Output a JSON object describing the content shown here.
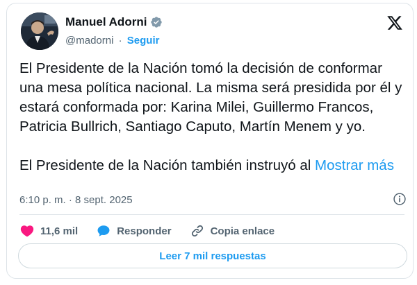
{
  "user": {
    "name": "Manuel Adorni",
    "handle": "@madorni",
    "separator": "·",
    "follow_label": "Seguir"
  },
  "tweet": {
    "paragraph1": "El Presidente de la Nación tomó la decisión de conformar una mesa política nacional. La misma será presidida por él y estará conformada por: Karina Milei, Guillermo Francos, Patricia Bullrich, Santiago Caputo, Martín Menem y yo.",
    "paragraph2": "El Presidente de la Nación también instruyó al ",
    "show_more": "Mostrar más",
    "timestamp": "6:10 p. m. · 8 sept. 2025"
  },
  "actions": {
    "likes_count": "11,6 mil",
    "reply_label": "Responder",
    "copy_link_label": "Copia enlace"
  },
  "replies_button_label": "Leer 7 mil respuestas",
  "icons": {
    "verified": "verified-badge-icon",
    "brand": "x-logo-icon",
    "info": "info-icon",
    "like": "heart-icon",
    "reply": "speech-bubble-icon",
    "copy_link": "link-icon"
  },
  "colors": {
    "accent": "#1d9bf0",
    "like": "#f91880",
    "text": "#0f1419",
    "muted": "#536471",
    "border": "#cfd9de"
  }
}
